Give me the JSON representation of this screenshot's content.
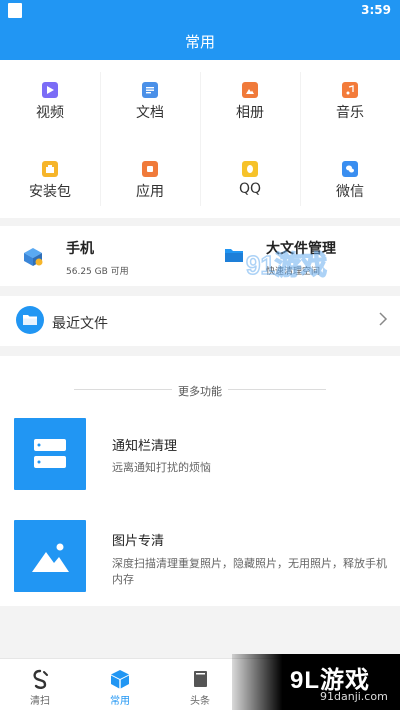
{
  "status": {
    "time": "3:59"
  },
  "appbar": {
    "title": "常用"
  },
  "categories": [
    {
      "label": "视频",
      "icon": "video-icon",
      "color": "#7b6cf6"
    },
    {
      "label": "文档",
      "icon": "document-icon",
      "color": "#4a90e8"
    },
    {
      "label": "相册",
      "icon": "photo-icon",
      "color": "#f07a3a"
    },
    {
      "label": "音乐",
      "icon": "music-icon",
      "color": "#f37b3a"
    },
    {
      "label": "安装包",
      "icon": "package-icon",
      "color": "#f6b52a"
    },
    {
      "label": "应用",
      "icon": "app-icon",
      "color": "#f07a3a"
    },
    {
      "label": "QQ",
      "icon": "qq-icon",
      "color": "#f6c22a"
    },
    {
      "label": "微信",
      "icon": "wechat-icon",
      "color": "#3a8ef0"
    }
  ],
  "storage": {
    "phone": {
      "name": "手机",
      "capacity": "56.25 GB 可用"
    },
    "bigfile": {
      "name": "大文件管理",
      "desc": "快速清理空间"
    }
  },
  "recent": {
    "label": "最近文件"
  },
  "more": {
    "title": "更多功能",
    "features": [
      {
        "title": "通知栏清理",
        "desc": "远离通知打扰的烦恼"
      },
      {
        "title": "图片专清",
        "desc": "深度扫描清理重复照片，隐藏照片，无用照片，释放手机内存"
      }
    ]
  },
  "nav": [
    {
      "label": "清扫",
      "active": false
    },
    {
      "label": "常用",
      "active": true
    },
    {
      "label": "头条",
      "active": false
    }
  ],
  "brand": {
    "logo": "9L游戏",
    "url": "91danji.com"
  },
  "watermark": {
    "text": "91游戏"
  },
  "colors": {
    "primary": "#2196f3"
  }
}
